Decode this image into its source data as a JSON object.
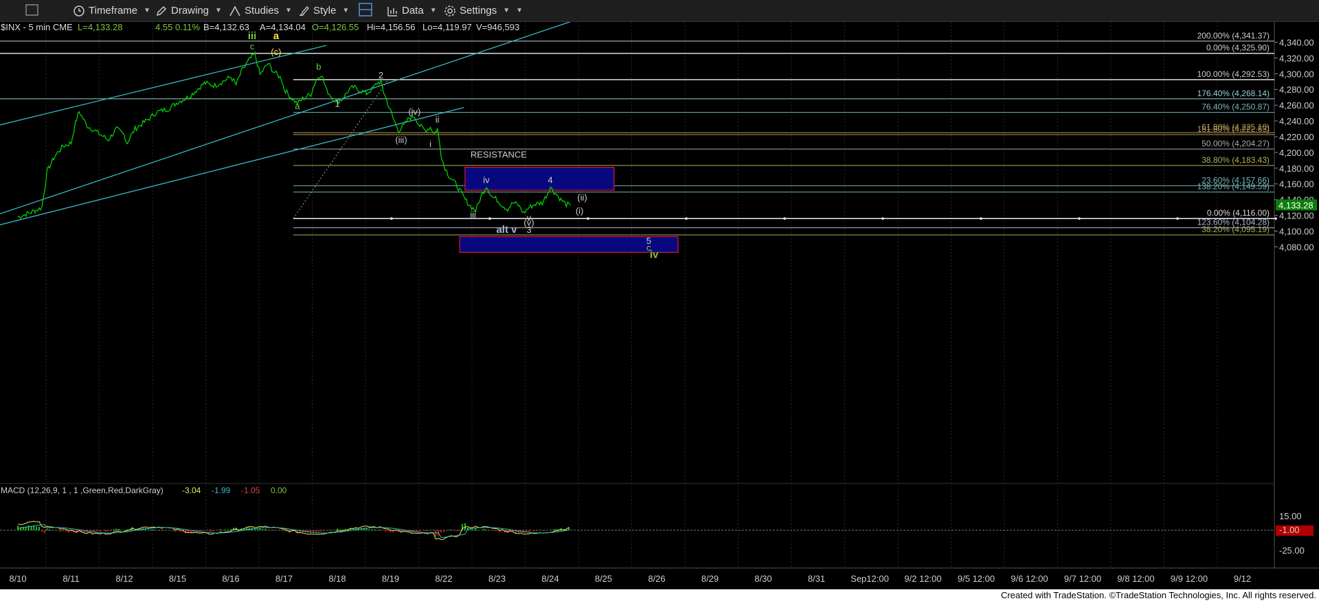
{
  "toolbar": {
    "timeframe": "Timeframe",
    "drawing": "Drawing",
    "studies": "Studies",
    "style": "Style",
    "data": "Data",
    "settings": "Settings"
  },
  "header": {
    "symbol": "$INX - 5 min  CME",
    "last": "L=4,133.28",
    "change": "4.55",
    "change_pct": "0.11%",
    "bid": "B=4,132.63",
    "ask": "A=4,134.04",
    "open": "O=4,126.55",
    "high": "Hi=4,156.56",
    "low": "Lo=4,119.97",
    "volume": "V=946,593"
  },
  "footer": "Created with TradeStation. ©TradeStation Technologies, Inc. All rights reserved.",
  "colors": {
    "price_line": "#00dd00",
    "wave_green": "#7cc83c",
    "wave_white": "#cccccc",
    "yellow": "#ffe24a",
    "channel": "#36b9c8",
    "fib_white": "#cfcfcf",
    "fib_teal": "#77b7b7",
    "fib_gold": "#b59d5a",
    "box_fill": "#08087e",
    "box_border": "#d1163a"
  },
  "chart_data": {
    "type": "line",
    "title": "$INX - 5 min",
    "price_axis": {
      "ticks": [
        "4,340.00",
        "4,320.00",
        "4,300.00",
        "4,280.00",
        "4,260.00",
        "4,240.00",
        "4,220.00",
        "4,200.00",
        "4,180.00",
        "4,160.00",
        "4,140.00",
        "4,120.00",
        "4,100.00",
        "4,080.00"
      ],
      "ylim": [
        4073,
        4352
      ],
      "last_price": "4,133.28"
    },
    "date_axis": [
      "8/10",
      "8/11",
      "8/12",
      "8/15",
      "8/16",
      "8/17",
      "8/18",
      "8/19",
      "8/22",
      "8/23",
      "8/24",
      "8/25",
      "8/26",
      "8/29",
      "8/30",
      "8/31",
      "Sep12:00",
      "9/2 12:00",
      "9/5 12:00",
      "9/6 12:00",
      "9/7 12:00",
      "9/8 12:00",
      "9/9 12:00",
      "9/12"
    ],
    "price_series": [
      [
        0,
        4118
      ],
      [
        0.25,
        4124
      ],
      [
        0.45,
        4130
      ],
      [
        0.55,
        4176
      ],
      [
        0.7,
        4196
      ],
      [
        0.85,
        4208
      ],
      [
        1.0,
        4212
      ],
      [
        1.08,
        4237
      ],
      [
        1.15,
        4252
      ],
      [
        1.3,
        4234
      ],
      [
        1.5,
        4225
      ],
      [
        1.7,
        4216
      ],
      [
        1.85,
        4230
      ],
      [
        2.0,
        4222
      ],
      [
        2.05,
        4212
      ],
      [
        2.2,
        4230
      ],
      [
        2.45,
        4242
      ],
      [
        2.6,
        4251
      ],
      [
        2.75,
        4254
      ],
      [
        2.85,
        4256
      ],
      [
        3.0,
        4264
      ],
      [
        3.2,
        4270
      ],
      [
        3.35,
        4279
      ],
      [
        3.5,
        4288
      ],
      [
        3.7,
        4285
      ],
      [
        3.9,
        4292
      ],
      [
        4.0,
        4296
      ],
      [
        4.1,
        4286
      ],
      [
        4.2,
        4303
      ],
      [
        4.35,
        4318
      ],
      [
        4.45,
        4325
      ],
      [
        4.55,
        4299
      ],
      [
        4.7,
        4313
      ],
      [
        4.8,
        4303
      ],
      [
        4.95,
        4294
      ],
      [
        5.0,
        4281
      ],
      [
        5.1,
        4272
      ],
      [
        5.25,
        4262
      ],
      [
        5.35,
        4268
      ],
      [
        5.5,
        4274
      ],
      [
        5.6,
        4292
      ],
      [
        5.7,
        4300
      ],
      [
        5.8,
        4279
      ],
      [
        5.9,
        4270
      ],
      [
        6.0,
        4264
      ],
      [
        6.1,
        4268
      ],
      [
        6.2,
        4278
      ],
      [
        6.3,
        4283
      ],
      [
        6.45,
        4278
      ],
      [
        6.55,
        4275
      ],
      [
        6.65,
        4280
      ],
      [
        6.75,
        4288
      ],
      [
        6.82,
        4290
      ],
      [
        6.86,
        4279
      ],
      [
        6.95,
        4262
      ],
      [
        7.05,
        4243
      ],
      [
        7.15,
        4228
      ],
      [
        7.25,
        4234
      ],
      [
        7.35,
        4244
      ],
      [
        7.45,
        4246
      ],
      [
        7.55,
        4234
      ],
      [
        7.65,
        4228
      ],
      [
        7.75,
        4232
      ],
      [
        7.82,
        4224
      ],
      [
        7.88,
        4230
      ],
      [
        7.95,
        4198
      ],
      [
        8.0,
        4184
      ],
      [
        8.1,
        4170
      ],
      [
        8.2,
        4162
      ],
      [
        8.3,
        4152
      ],
      [
        8.4,
        4140
      ],
      [
        8.5,
        4132
      ],
      [
        8.6,
        4126
      ],
      [
        8.7,
        4144
      ],
      [
        8.8,
        4158
      ],
      [
        8.9,
        4144
      ],
      [
        9.0,
        4140
      ],
      [
        9.1,
        4133
      ],
      [
        9.2,
        4128
      ],
      [
        9.3,
        4136
      ],
      [
        9.4,
        4133
      ],
      [
        9.5,
        4123
      ],
      [
        9.6,
        4130
      ],
      [
        9.7,
        4134
      ],
      [
        9.85,
        4136
      ],
      [
        9.95,
        4148
      ],
      [
        10.0,
        4156
      ],
      [
        10.1,
        4148
      ],
      [
        10.2,
        4140
      ],
      [
        10.3,
        4134
      ],
      [
        10.38,
        4133
      ]
    ],
    "fib_levels": [
      {
        "label": "200.00% (4,341.37)",
        "value": 4341.37,
        "color": "#cfcfcf"
      },
      {
        "label": "0.00% (4,325.90)",
        "value": 4325.9,
        "color": "#cfcfcf"
      },
      {
        "label": "100.00% (4,292.53)",
        "value": 4292.53,
        "color": "#cfcfcf"
      },
      {
        "label": "176.40% (4,268.14)",
        "value": 4268.14,
        "color": "#9ad0d8"
      },
      {
        "label": "76.40% (4,250.87)",
        "value": 4250.87,
        "color": "#77b7b7"
      },
      {
        "label": "61.80% (4,225.10)",
        "value": 4225.1,
        "color": "#b59d5a"
      },
      {
        "label": "161.80% (4,222.63)",
        "value": 4222.63,
        "color": "#b59d5a"
      },
      {
        "label": "50.00% (4,204.27)",
        "value": 4204.27,
        "color": "#aaaaaa"
      },
      {
        "label": "38.80% (4,183.43)",
        "value": 4183.43,
        "color": "#b5b05a"
      },
      {
        "label": "23.60% (4,157.66)",
        "value": 4157.66,
        "color": "#77b7b7"
      },
      {
        "label": "138.20% (4,149.59)",
        "value": 4149.59,
        "color": "#77b7b7"
      },
      {
        "label": "0.00% (4,116.00)",
        "value": 4116.0,
        "color": "#dddddd"
      },
      {
        "label": "123.60% (4,104.28)",
        "value": 4104.28,
        "color": "#aab8d8"
      },
      {
        "label": "38.20% (4,095.19)",
        "value": 4095.19,
        "color": "#b5b05a"
      }
    ],
    "boxes": [
      {
        "name": "resistance-box",
        "label": "RESISTANCE",
        "x0": 8.45,
        "x1": 11.2,
        "y0": 4152,
        "y1": 4181
      },
      {
        "name": "support-box",
        "label": "",
        "x0": 8.35,
        "x1": 12.4,
        "y0": 4073,
        "y1": 4093
      }
    ],
    "wave_labels": [
      {
        "text": "iii",
        "x": 4.4,
        "y": 4344,
        "color": "#7cc83c",
        "bold": true
      },
      {
        "text": "a",
        "x": 4.85,
        "y": 4344,
        "color": "#ffe24a",
        "bold": true
      },
      {
        "text": "c",
        "x": 4.4,
        "y": 4331,
        "color": "#7cc83c"
      },
      {
        "text": "(c)",
        "x": 4.85,
        "y": 4324,
        "color": "#ffe24a"
      },
      {
        "text": "b",
        "x": 5.65,
        "y": 4305,
        "color": "#7cc83c"
      },
      {
        "text": "2",
        "x": 6.82,
        "y": 4294,
        "color": "#cccccc"
      },
      {
        "text": "a",
        "x": 5.25,
        "y": 4255,
        "color": "#7cc83c"
      },
      {
        "text": "1",
        "x": 6.0,
        "y": 4258,
        "color": "#cccccc"
      },
      {
        "text": "(iv)",
        "x": 7.45,
        "y": 4248,
        "color": "#cccccc"
      },
      {
        "text": "ii",
        "x": 7.88,
        "y": 4238,
        "color": "#cccccc"
      },
      {
        "text": "(iii)",
        "x": 7.2,
        "y": 4212,
        "color": "#cccccc"
      },
      {
        "text": "i",
        "x": 7.75,
        "y": 4207,
        "color": "#cccccc"
      },
      {
        "text": "iv",
        "x": 8.8,
        "y": 4161,
        "color": "#cccccc"
      },
      {
        "text": "4",
        "x": 10.0,
        "y": 4161,
        "color": "#cccccc"
      },
      {
        "text": "(ii)",
        "x": 10.6,
        "y": 4139,
        "color": "#cccccc"
      },
      {
        "text": "(i)",
        "x": 10.55,
        "y": 4122,
        "color": "#cccccc"
      },
      {
        "text": "iii",
        "x": 8.55,
        "y": 4117,
        "color": "#cccccc"
      },
      {
        "text": "v",
        "x": 9.6,
        "y": 4113,
        "color": "#cccccc"
      },
      {
        "text": "(v)",
        "x": 9.6,
        "y": 4107,
        "color": "#cccccc"
      },
      {
        "text": "3",
        "x": 9.6,
        "y": 4098,
        "color": "#cccccc"
      },
      {
        "text": "alt v",
        "x": 9.18,
        "y": 4098,
        "color": "#aab8d8",
        "bold": true
      },
      {
        "text": "5",
        "x": 11.85,
        "y": 4084,
        "color": "#cccccc"
      },
      {
        "text": "c",
        "x": 11.85,
        "y": 4075,
        "color": "#7cc83c"
      },
      {
        "text": "iv",
        "x": 11.95,
        "y": 4066,
        "color": "#7cc83c",
        "bold": true
      }
    ],
    "macd": {
      "label": "MACD (12,26,9, 1 , 1 ,Green,Red,DarkGray)",
      "values": [
        "-3.04",
        "-1.99",
        "-1.05",
        "0.00"
      ],
      "axis": [
        "15.00",
        "-1.00",
        "-25.00"
      ]
    }
  }
}
